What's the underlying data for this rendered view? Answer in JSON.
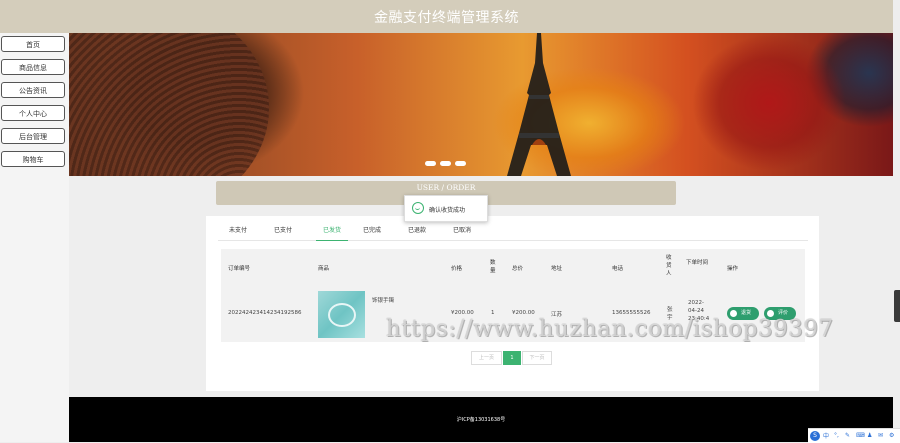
{
  "header": {
    "title": "金融支付终端管理系统"
  },
  "nav": {
    "items": [
      "首页",
      "商品信息",
      "公告资讯",
      "个人中心",
      "后台管理",
      "购物车"
    ]
  },
  "section": {
    "title": "USER / ORDER"
  },
  "toast": {
    "message": "确认收货成功"
  },
  "tabs": [
    "未支付",
    "已支付",
    "已发货",
    "已完成",
    "已退款",
    "已取消"
  ],
  "active_tab": "已发货",
  "table": {
    "headers": {
      "order_no": "订单编号",
      "product": "商品",
      "price": "价格",
      "qty": "数量",
      "total": "总价",
      "address": "地址",
      "phone": "电话",
      "receiver": "收货人",
      "time": "下单时间",
      "ops": "操作"
    },
    "row": {
      "order_no": "20224242341423419258​6",
      "product": "饰银手镯",
      "price": "¥200.00",
      "qty": "1",
      "total": "¥200.00",
      "address": "江苏",
      "phone": "13655555526",
      "receiver": "张宇",
      "time": "2022-04-24 23:40:4",
      "refund_label": "退货",
      "review_label": "评价"
    }
  },
  "pagination": {
    "prev": "上一页",
    "current": "1",
    "next": "下一页"
  },
  "footer": {
    "icp": "沪ICP备13031638号"
  },
  "watermark": "https://www.huzhan.com/ishop39397",
  "ime": {
    "label": "中",
    "icons": [
      "°,",
      "✎",
      "⌨",
      "♟",
      "✉",
      "⚙"
    ]
  },
  "colors": {
    "header_bg": "#d4cdbb",
    "accent": "#3cb371",
    "op_button": "#2e9e6e",
    "footer_bg": "#000000"
  }
}
